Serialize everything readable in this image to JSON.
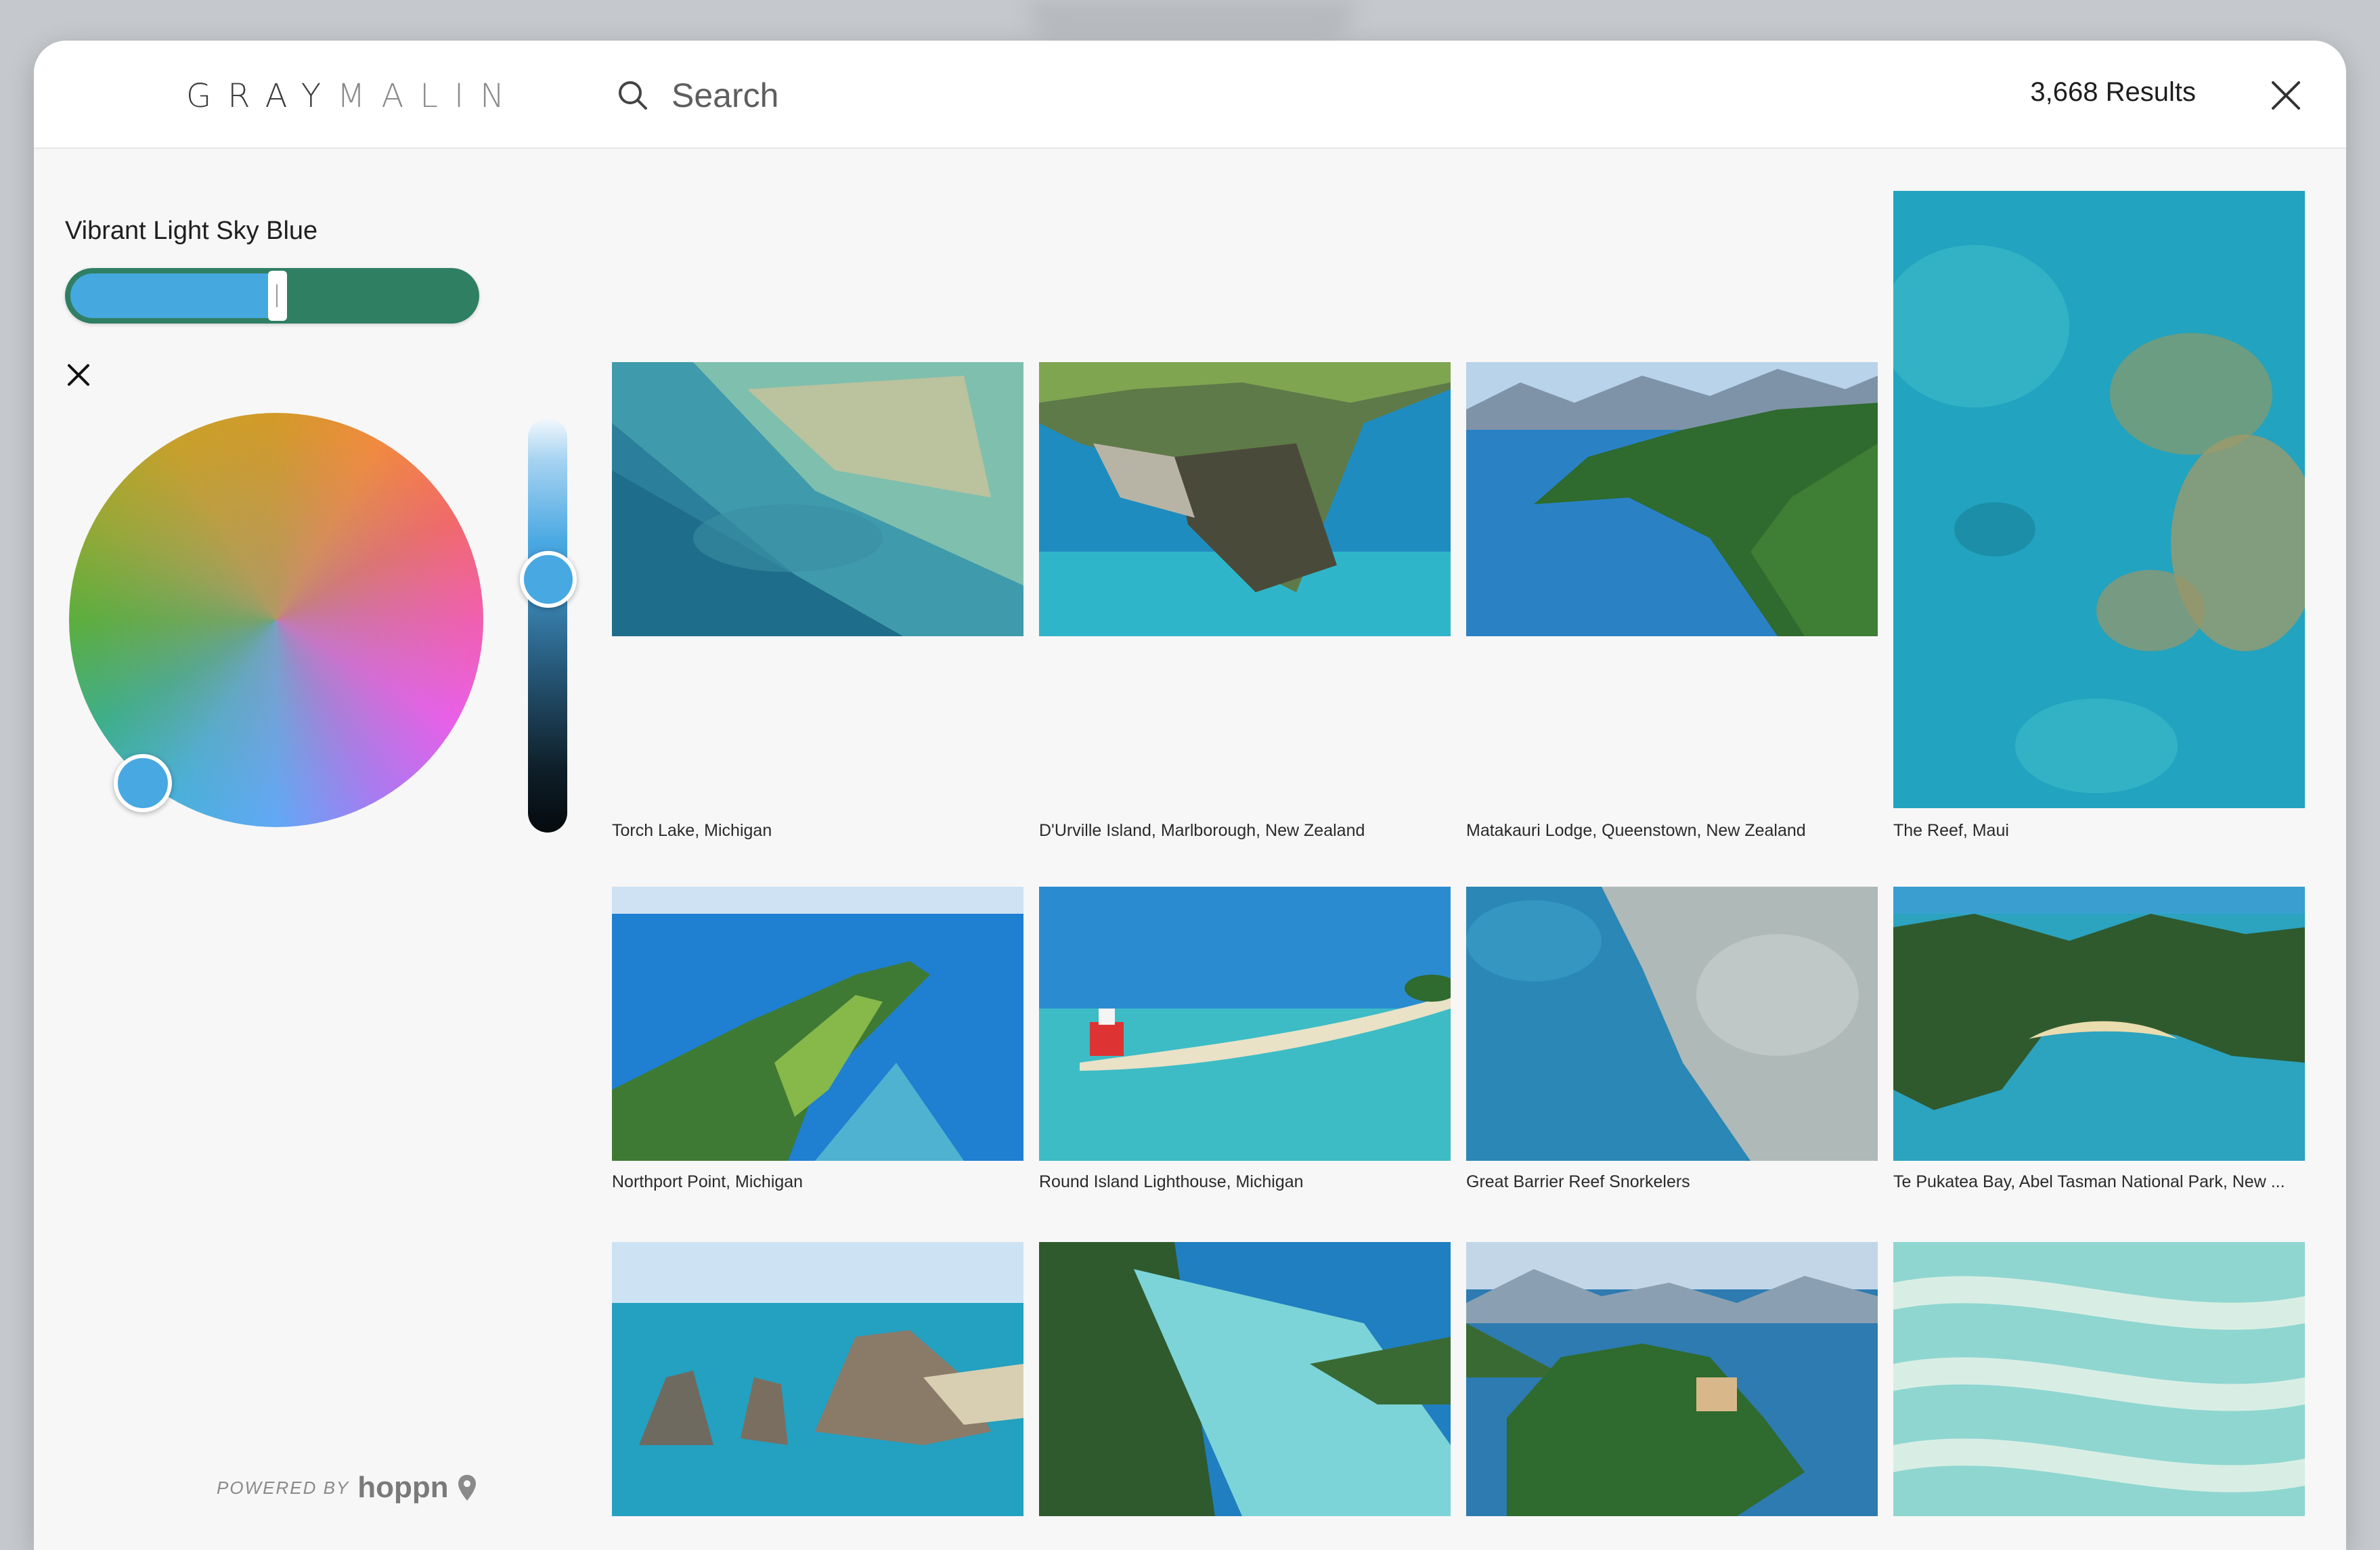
{
  "header": {
    "logo_part1": "GRAY",
    "logo_part2": "MALIN",
    "search_placeholder": "Search",
    "results": "3,668 Results"
  },
  "sidebar": {
    "selected_color_name": "Vibrant Light Sky Blue",
    "selected_color": "#45a8df",
    "secondary_color": "#2f7f63",
    "powered_by_label": "POWERED BY",
    "powered_by_brand": "hoppn"
  },
  "gallery": {
    "items": [
      {
        "caption": "Torch Lake, Michigan"
      },
      {
        "caption": "D'Urville Island, Marlborough, New Zealand"
      },
      {
        "caption": "Matakauri Lodge, Queenstown, New Zealand"
      },
      {
        "caption": "The Reef, Maui"
      },
      {
        "caption": "Northport Point, Michigan"
      },
      {
        "caption": "Round Island Lighthouse, Michigan"
      },
      {
        "caption": "Great Barrier Reef Snorkelers"
      },
      {
        "caption": "Te Pukatea Bay, Abel Tasman National Park, New ..."
      },
      {
        "caption": ""
      },
      {
        "caption": ""
      },
      {
        "caption": ""
      },
      {
        "caption": ""
      }
    ]
  },
  "colors": {
    "accent": "#45a8df",
    "ocean": "#1f8fc4",
    "turquoise": "#3cc3c9",
    "forest": "#2f6a2e",
    "sand": "#e8e1c8"
  }
}
